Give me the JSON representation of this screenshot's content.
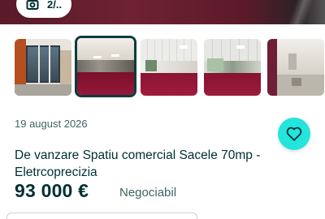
{
  "gallery": {
    "photo_count": "2/..",
    "thumbnails": [
      {
        "label": "exterior"
      },
      {
        "label": "interior-1"
      },
      {
        "label": "interior-2"
      },
      {
        "label": "interior-3"
      },
      {
        "label": "interior-4"
      }
    ],
    "selected_index": 1
  },
  "listing": {
    "date": "19 august 2026",
    "title": "De vanzare Spatiu comercial Sacele 70mp - Eletrcoprecizia",
    "price": "93 000 €",
    "negotiable": "Negociabil"
  },
  "colors": {
    "accent": "#23e5db",
    "text_primary": "#002f34",
    "text_secondary": "#406367",
    "carpet": "#8b1530"
  },
  "icons": {
    "favorite": "heart-icon",
    "photos": "camera-icon"
  }
}
